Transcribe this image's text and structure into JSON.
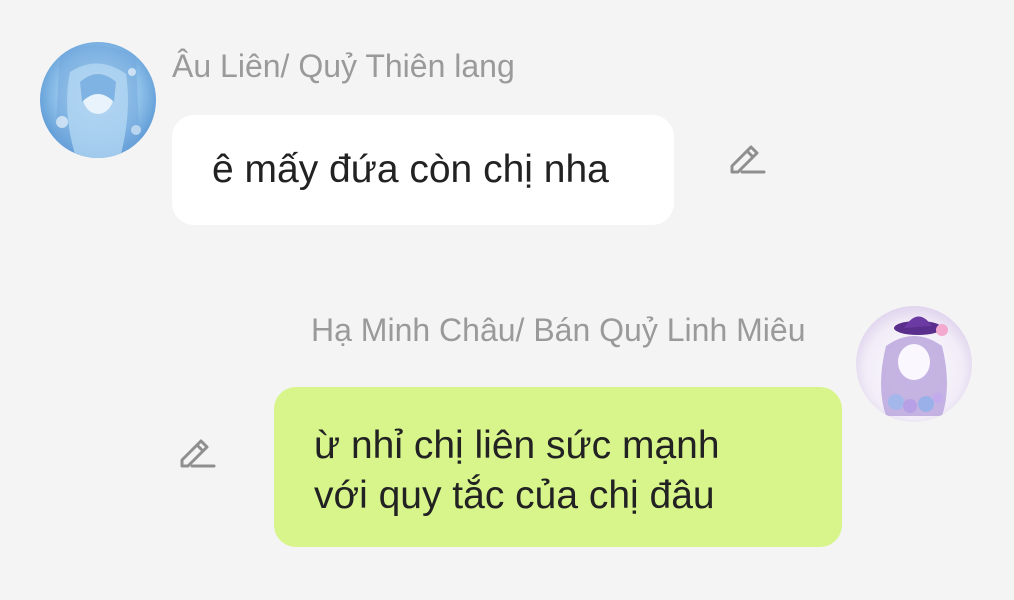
{
  "messages": [
    {
      "sender": "Âu Liên/ Quỷ Thiên lang",
      "avatar_icon": "anime-avatar-blue",
      "text": "ê mấy đứa còn chị nha",
      "bubble_color": "#ffffff",
      "edit_icon": "pencil-edit-icon"
    },
    {
      "sender": "Hạ Minh Châu/ Bán Quỷ Linh Miêu",
      "avatar_icon": "anime-avatar-purple",
      "lines": [
        "ừ nhỉ chị liên sức mạnh",
        "với quy tắc của chị đâu"
      ],
      "bubble_color": "#d8f58c",
      "edit_icon": "pencil-edit-icon"
    }
  ],
  "colors": {
    "background": "#f4f4f4",
    "name_text": "#9a9a9a",
    "message_text": "#222222",
    "icon": "#8f8f8f"
  }
}
